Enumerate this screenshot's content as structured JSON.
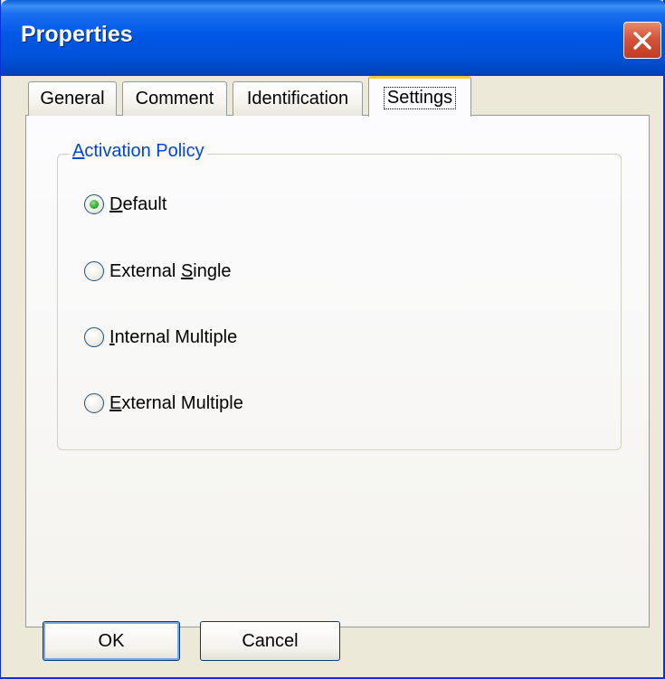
{
  "window": {
    "title": "Properties"
  },
  "tabs": [
    {
      "label": "General"
    },
    {
      "label": "Comment"
    },
    {
      "label": "Identification"
    },
    {
      "label": "Settings"
    }
  ],
  "active_tab": "Settings",
  "group": {
    "title": "Activation Policy"
  },
  "options": [
    {
      "label": "Default",
      "selected": true
    },
    {
      "label": "External Single",
      "selected": false
    },
    {
      "label": "Internal Multiple",
      "selected": false
    },
    {
      "label": "External Multiple",
      "selected": false
    }
  ],
  "buttons": {
    "ok": "OK",
    "cancel": "Cancel"
  },
  "colors": {
    "titlebar": "#0058e6",
    "group_title": "#0046d5",
    "active_tab_accent": "#ffc83c",
    "close_button": "#d4533a"
  }
}
